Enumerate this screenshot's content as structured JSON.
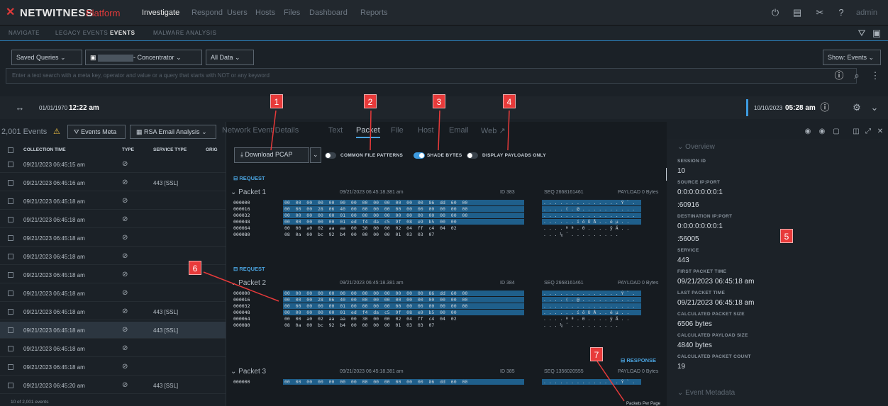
{
  "topbar": {
    "logo": "NETWITNESS",
    "logo_suffix": "Platform",
    "nav": [
      "Investigate",
      "Respond",
      "Users",
      "Hosts",
      "Files",
      "Dashboard",
      "Reports"
    ],
    "user": "admin"
  },
  "subnav": [
    "NAVIGATE",
    "LEGACY EVENTS",
    "EVENTS",
    "MALWARE ANALYSIS"
  ],
  "query": {
    "saved": "Saved Queries",
    "concentrator": "- Concentrator",
    "range": "All Data",
    "show": "Show: Events",
    "hint": "Enter a text search with a meta key, operator and value or a query that starts with NOT or any keyword"
  },
  "time": {
    "start_date": "01/01/1970",
    "start_time": "12:22 am",
    "end_date": "10/10/2023",
    "end_time": "05:28 am"
  },
  "events": {
    "count": "2,001 Events",
    "meta_btn": "Events Meta",
    "email_btn": "RSA Email Analysis",
    "cols": [
      "COLLECTION TIME",
      "TYPE",
      "SERVICE TYPE",
      "ORIG"
    ],
    "rows": [
      {
        "time": "09/21/2023 06:45:15 am",
        "svc": ""
      },
      {
        "time": "09/21/2023 06:45:16 am",
        "svc": "443 [SSL]"
      },
      {
        "time": "09/21/2023 06:45:18 am",
        "svc": ""
      },
      {
        "time": "09/21/2023 06:45:18 am",
        "svc": ""
      },
      {
        "time": "09/21/2023 06:45:18 am",
        "svc": ""
      },
      {
        "time": "09/21/2023 06:45:18 am",
        "svc": ""
      },
      {
        "time": "09/21/2023 06:45:18 am",
        "svc": ""
      },
      {
        "time": "09/21/2023 06:45:18 am",
        "svc": ""
      },
      {
        "time": "09/21/2023 06:45:18 am",
        "svc": "443 [SSL]"
      },
      {
        "time": "09/21/2023 06:45:18 am",
        "svc": "443 [SSL]"
      },
      {
        "time": "09/21/2023 06:45:18 am",
        "svc": ""
      },
      {
        "time": "09/21/2023 06:45:18 am",
        "svc": ""
      },
      {
        "time": "09/21/2023 06:45:20 am",
        "svc": "443 [SSL]"
      }
    ],
    "footer": "10 of 2,001 events"
  },
  "detail": {
    "tabs": [
      "Network Event Details",
      "Text",
      "Packet",
      "File",
      "Host",
      "Email",
      "Web"
    ],
    "download": "Download PCAP",
    "toggles": [
      "COMMON FILE PATTERNS",
      "SHADE BYTES",
      "DISPLAY PAYLOADS ONLY"
    ],
    "request": "REQUEST",
    "response": "RESPONSE",
    "packets": [
      {
        "name": "Packet 1",
        "time": "09/21/2023 06:45:18.381 am",
        "id": "ID 383",
        "seq": "SEQ 2668161461",
        "payload": "PAYLOAD 0 Bytes"
      },
      {
        "name": "Packet 2",
        "time": "09/21/2023 06:45:18.381 am",
        "id": "ID 384",
        "seq": "SEQ 2668161461",
        "payload": "PAYLOAD 0 Bytes"
      },
      {
        "name": "Packet 3",
        "time": "09/21/2023 06:45:18.381 am",
        "id": "ID 385",
        "seq": "SEQ 1356020555",
        "payload": "PAYLOAD 0 Bytes"
      }
    ],
    "offsets": [
      "000000",
      "000016",
      "000032",
      "000048",
      "000064",
      "000080"
    ],
    "hex": [
      "00  00  00  00  00  00  00  00  00  00  00  00  00  86  dd  60  00",
      "00  00  00  28  06  40  00  00  00  00  00  00  00  00  00  00  00",
      "00  00  00  00  00  01  00  00  00  00  00  00  00  00  00  00  00",
      "00  00  00  00  00  01  ed  f4  da  c5  9f  08  e9  b5  00  00",
      "00  00  a0  02  aa  aa  00  30  00  00  02  04  ff  c4  04  02",
      "08  0a  00  bc  92  b4  00  00  00  00  01  03  03  07"
    ],
    "ascii": [
      ". . . . . . . . . . . . . . Ý ` .",
      ". . . . ( . @ . . . . . . . . . .",
      ". . . . . . . . . . . . . . . . .",
      ". . . . . . í ô Ú Å . . é µ . .",
      ". . . . ª ª . 0 . . . . ÿ Ä . .",
      ". . . ¼ ´ . . . . . . . . ."
    ],
    "pkts_per_page": "Packets Per Page"
  },
  "overview": {
    "title": "Overview",
    "fields": [
      {
        "label": "SESSION ID",
        "value": "10"
      },
      {
        "label": "SOURCE IP:PORT",
        "value": "0:0:0:0:0:0:0:1"
      },
      {
        "label": "",
        "value": ":60916"
      },
      {
        "label": "DESTINATION IP:PORT",
        "value": "0:0:0:0:0:0:0:1"
      },
      {
        "label": "",
        "value": ":56005"
      },
      {
        "label": "SERVICE",
        "value": "443"
      },
      {
        "label": "FIRST PACKET TIME",
        "value": "09/21/2023 06:45:18 am"
      },
      {
        "label": "LAST PACKET TIME",
        "value": "09/21/2023 06:45:18 am"
      },
      {
        "label": "CALCULATED PACKET SIZE",
        "value": "6506 bytes"
      },
      {
        "label": "CALCULATED PAYLOAD SIZE",
        "value": "4840 bytes"
      },
      {
        "label": "CALCULATED PACKET COUNT",
        "value": "19"
      }
    ],
    "meta": "Event Metadata"
  },
  "callouts": [
    "1",
    "2",
    "3",
    "4",
    "5",
    "6",
    "7"
  ]
}
